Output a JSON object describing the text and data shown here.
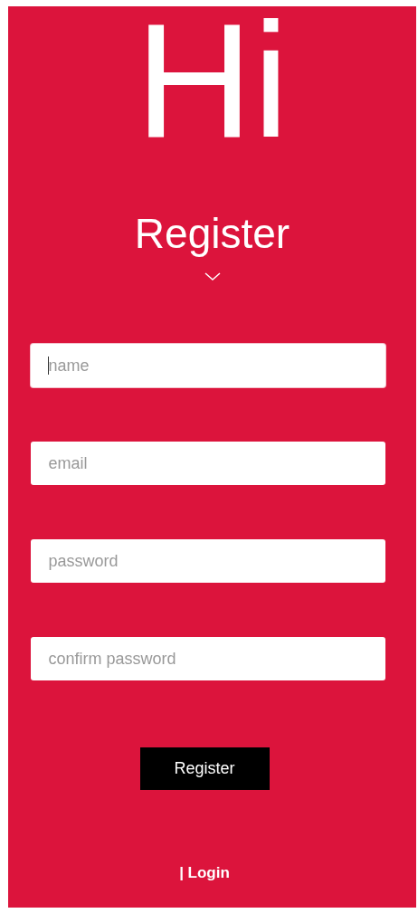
{
  "greeting": "Hi",
  "title": "Register",
  "fields": [
    {
      "placeholder": "name",
      "focused": true
    },
    {
      "placeholder": "email",
      "focused": false
    },
    {
      "placeholder": "password",
      "focused": false
    },
    {
      "placeholder": "confirm password",
      "focused": false
    }
  ],
  "submit_button": "Register",
  "login_link": "| Login"
}
